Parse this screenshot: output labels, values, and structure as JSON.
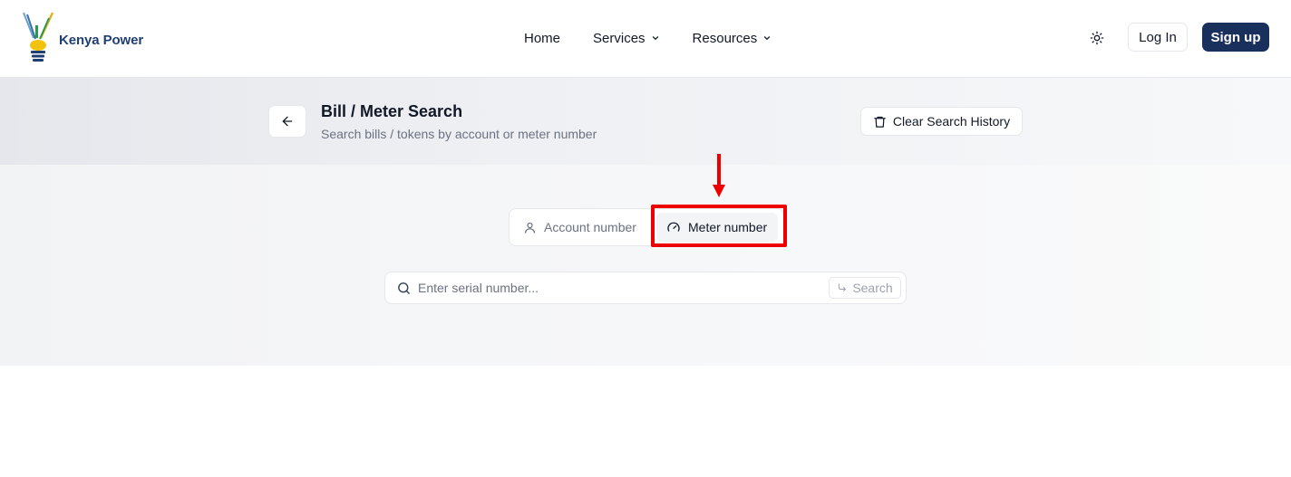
{
  "brand": {
    "name": "Kenya Power"
  },
  "nav": {
    "items": [
      {
        "label": "Home",
        "has_dropdown": false
      },
      {
        "label": "Services",
        "has_dropdown": true
      },
      {
        "label": "Resources",
        "has_dropdown": true
      }
    ]
  },
  "header": {
    "theme_icon": "sun-icon",
    "login_label": "Log In",
    "signup_label": "Sign up"
  },
  "page": {
    "title": "Bill / Meter Search",
    "subtitle": "Search bills / tokens by account or meter number",
    "clear_history_label": "Clear Search History"
  },
  "tabs": [
    {
      "label": "Account number",
      "icon": "user-icon",
      "active": false
    },
    {
      "label": "Meter number",
      "icon": "gauge-icon",
      "active": true
    }
  ],
  "search": {
    "placeholder": "Enter serial number...",
    "value": "",
    "button_label": "Search"
  },
  "colors": {
    "brand_navy": "#19305d",
    "annotation_red": "#ee0000",
    "logo_blue": "#1f3f74"
  }
}
